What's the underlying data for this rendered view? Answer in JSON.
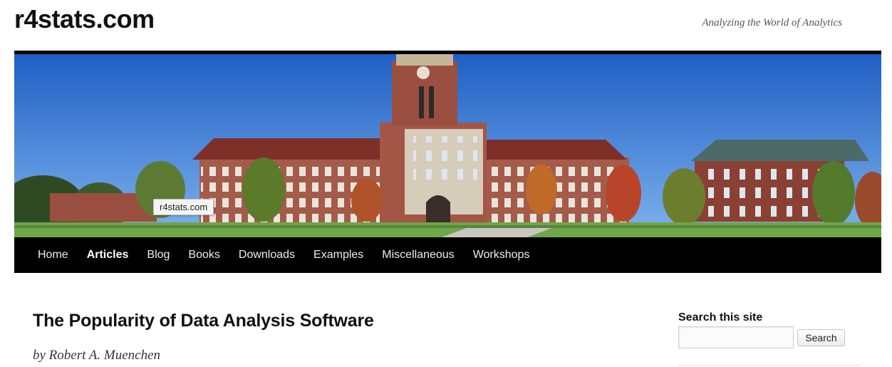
{
  "site": {
    "title": "r4stats.com",
    "description": "Analyzing the World of Analytics"
  },
  "banner": {
    "tooltip": "r4stats.com"
  },
  "nav": {
    "items": [
      {
        "label": "Home",
        "active": false
      },
      {
        "label": "Articles",
        "active": true
      },
      {
        "label": "Blog",
        "active": false
      },
      {
        "label": "Books",
        "active": false
      },
      {
        "label": "Downloads",
        "active": false
      },
      {
        "label": "Examples",
        "active": false
      },
      {
        "label": "Miscellaneous",
        "active": false
      },
      {
        "label": "Workshops",
        "active": false
      }
    ]
  },
  "post": {
    "title": "The Popularity of Data Analysis Software",
    "byline": "by Robert A. Muenchen"
  },
  "sidebar": {
    "search": {
      "title": "Search this site",
      "placeholder": "",
      "value": "",
      "button_label": "Search"
    }
  },
  "colors": {
    "nav_bg": "#000000",
    "sky": "#2f6fd0",
    "brick": "#a35a4a",
    "lawn": "#6fa64a"
  }
}
